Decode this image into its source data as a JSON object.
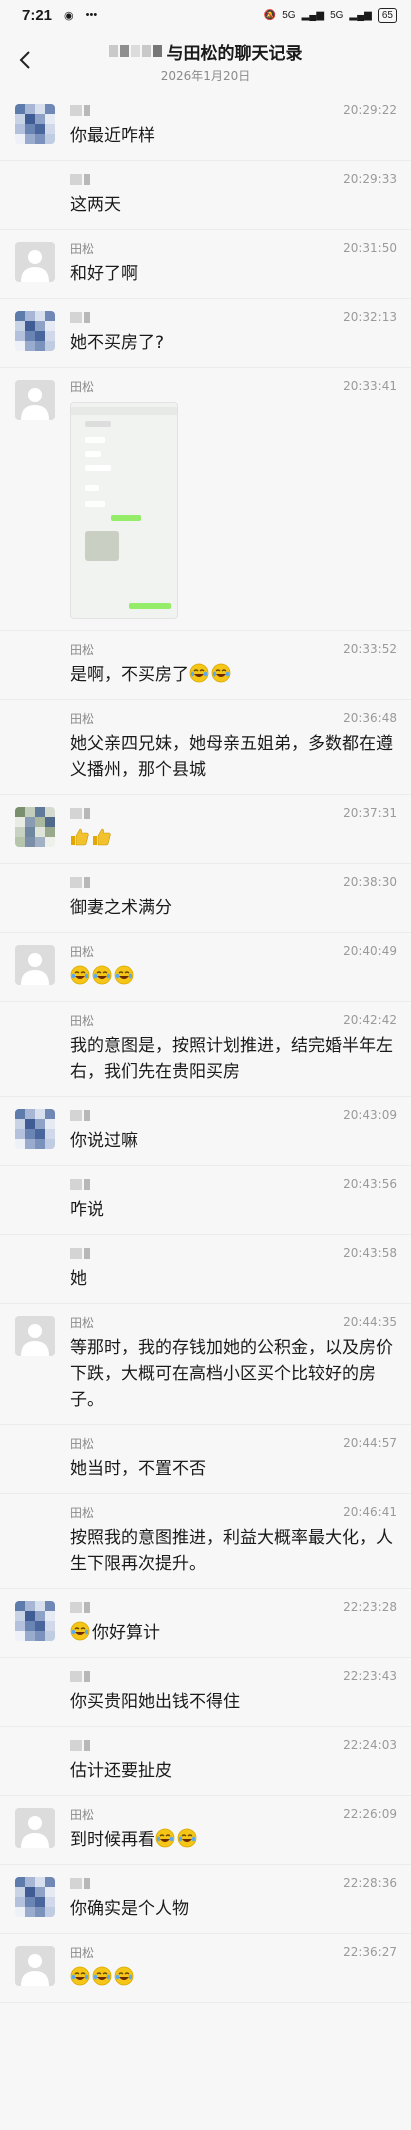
{
  "status": {
    "time": "7:21",
    "network": "5G",
    "battery": "65"
  },
  "header": {
    "title": "与田松的聊天记录",
    "date": "2026年1月20日"
  },
  "messages": [
    {
      "sender": "",
      "time": "20:29:22",
      "text": "你最近咋样",
      "avatar": "mosaic-blue"
    },
    {
      "sender": "",
      "time": "20:29:33",
      "text": "这两天",
      "avatar": "none"
    },
    {
      "sender": "田松",
      "time": "20:31:50",
      "text": "和好了啊",
      "avatar": "default"
    },
    {
      "sender": "",
      "time": "20:32:13",
      "text": "她不买房了?",
      "avatar": "mosaic-blue"
    },
    {
      "sender": "田松",
      "time": "20:33:41",
      "text": "",
      "avatar": "default",
      "image": true
    },
    {
      "sender": "田松",
      "time": "20:33:52",
      "text": "是啊，不买房了",
      "avatar": "none",
      "emojis": 2
    },
    {
      "sender": "田松",
      "time": "20:36:48",
      "text": "她父亲四兄妹，她母亲五姐弟，多数都在遵义播州，那个县城",
      "avatar": "none"
    },
    {
      "sender": "",
      "time": "20:37:31",
      "text": "",
      "avatar": "mosaic-green",
      "thumbs": 2
    },
    {
      "sender": "",
      "time": "20:38:30",
      "text": "御妻之术满分",
      "avatar": "none"
    },
    {
      "sender": "田松",
      "time": "20:40:49",
      "text": "",
      "avatar": "default",
      "emojis": 3
    },
    {
      "sender": "田松",
      "time": "20:42:42",
      "text": "我的意图是，按照计划推进，结完婚半年左右，我们先在贵阳买房",
      "avatar": "none"
    },
    {
      "sender": "",
      "time": "20:43:09",
      "text": "你说过嘛",
      "avatar": "mosaic-blue"
    },
    {
      "sender": "",
      "time": "20:43:56",
      "text": "咋说",
      "avatar": "none"
    },
    {
      "sender": "",
      "time": "20:43:58",
      "text": "她",
      "avatar": "none"
    },
    {
      "sender": "田松",
      "time": "20:44:35",
      "text": "等那时，我的存钱加她的公积金，以及房价下跌，大概可在高档小区买个比较好的房子。",
      "avatar": "default"
    },
    {
      "sender": "田松",
      "time": "20:44:57",
      "text": "她当时，不置不否",
      "avatar": "none"
    },
    {
      "sender": "田松",
      "time": "20:46:41",
      "text": "按照我的意图推进，利益大概率最大化，人生下限再次提升。",
      "avatar": "none"
    },
    {
      "sender": "",
      "time": "22:23:28",
      "text": "你好算计",
      "avatar": "mosaic-blue",
      "emojis_before": 1
    },
    {
      "sender": "",
      "time": "22:23:43",
      "text": "你买贵阳她出钱不得住",
      "avatar": "none"
    },
    {
      "sender": "",
      "time": "22:24:03",
      "text": "估计还要扯皮",
      "avatar": "none"
    },
    {
      "sender": "田松",
      "time": "22:26:09",
      "text": "到时候再看",
      "avatar": "default",
      "emojis": 2
    },
    {
      "sender": "",
      "time": "22:28:36",
      "text": "你确实是个人物",
      "avatar": "mosaic-blue"
    },
    {
      "sender": "田松",
      "time": "22:36:27",
      "text": "",
      "avatar": "default",
      "emojis": 3
    }
  ],
  "icons": {
    "back": "back-arrow-icon",
    "avatar_default": "person-icon",
    "emoji": "laughing-crying-emoji-icon",
    "thumb": "thumbs-up-icon"
  },
  "colors": {
    "background": "#f7f7f7",
    "meta": "#9a9a9a",
    "emoji": "#f5c518",
    "thumb": "#f2c12e",
    "bubble_green": "#95ec69"
  }
}
